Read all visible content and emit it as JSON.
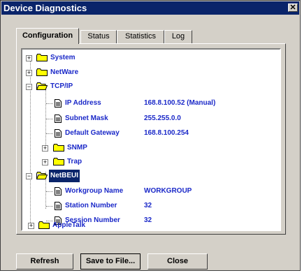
{
  "window": {
    "title": "Device Diagnostics",
    "close_glyph": "✕"
  },
  "tabs": [
    {
      "label": "Configuration",
      "active": true
    },
    {
      "label": "Status",
      "active": false
    },
    {
      "label": "Statistics",
      "active": false
    },
    {
      "label": "Log",
      "active": false
    }
  ],
  "tree": {
    "system": "System",
    "netware": "NetWare",
    "tcpip": {
      "label": "TCP/IP",
      "ip_label": "IP Address",
      "ip_value": "168.8.100.52 (Manual)",
      "mask_label": "Subnet Mask",
      "mask_value": "255.255.0.0",
      "gw_label": "Default Gateway",
      "gw_value": "168.8.100.254",
      "snmp": "SNMP",
      "trap": "Trap"
    },
    "netbeui": {
      "label": "NetBEUI",
      "wg_label": "Workgroup Name",
      "wg_value": "WORKGROUP",
      "station_label": "Station Number",
      "station_value": "32",
      "session_label": "Session Number",
      "session_value": "32"
    },
    "appletalk": "AppleTalk",
    "expand_glyph": "+",
    "collapse_glyph": "−"
  },
  "buttons": {
    "refresh": "Refresh",
    "save": "Save to File...",
    "close": "Close"
  },
  "colors": {
    "titlebar": "#0a246a",
    "tree_text": "#1a28c8",
    "folder": "#ffff00"
  }
}
